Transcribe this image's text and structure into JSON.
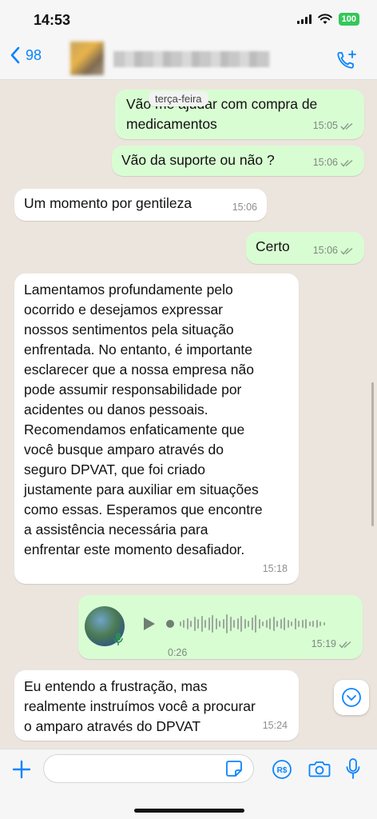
{
  "status_bar": {
    "time": "14:53",
    "battery": "100"
  },
  "header": {
    "back_count": "98",
    "contact_name": "",
    "accent_color": "#0a84ff"
  },
  "chat": {
    "date_chip": "terça-feira",
    "messages": [
      {
        "direction": "out",
        "text": "Vão me ajudar com compra de\nmedicamentos",
        "time": "15:05"
      },
      {
        "direction": "out",
        "text": "Vão da suporte ou não ?",
        "time": "15:06"
      },
      {
        "direction": "in",
        "text": "Um momento por gentileza",
        "time": "15:06"
      },
      {
        "direction": "out",
        "text": "Certo",
        "time": "15:06"
      },
      {
        "direction": "in",
        "text": "Lamentamos profundamente pelo\nocorrido e desejamos expressar\nnossos sentimentos pela situação\nenfrentada. No entanto, é importante\nesclarecer que a nossa empresa não\npode assumir responsabilidade por\nacidentes ou danos pessoais.\nRecomendamos enfaticamente que\nvocê busque amparo através do\nseguro DPVAT, que foi criado\njustamente para auxiliar em situações\ncomo essas. Esperamos que encontre\na assistência necessária para\nenfrentar este momento desafiador.",
        "time": "15:18"
      },
      {
        "direction": "out",
        "type": "voice",
        "duration": "0:26",
        "time": "15:19"
      },
      {
        "direction": "in",
        "text": "Eu entendo a frustração, mas\nrealmente instruímos você a procurar\no amparo através do DPVAT",
        "time": "15:24"
      }
    ],
    "colors": {
      "outgoing_bubble": "#d9fdd3",
      "incoming_bubble": "#ffffff",
      "background": "#ece5dd"
    }
  },
  "input_bar": {
    "placeholder": "",
    "icons": [
      "plus-icon",
      "sticker-icon",
      "pix-payment-icon",
      "camera-icon",
      "microphone-icon"
    ]
  }
}
